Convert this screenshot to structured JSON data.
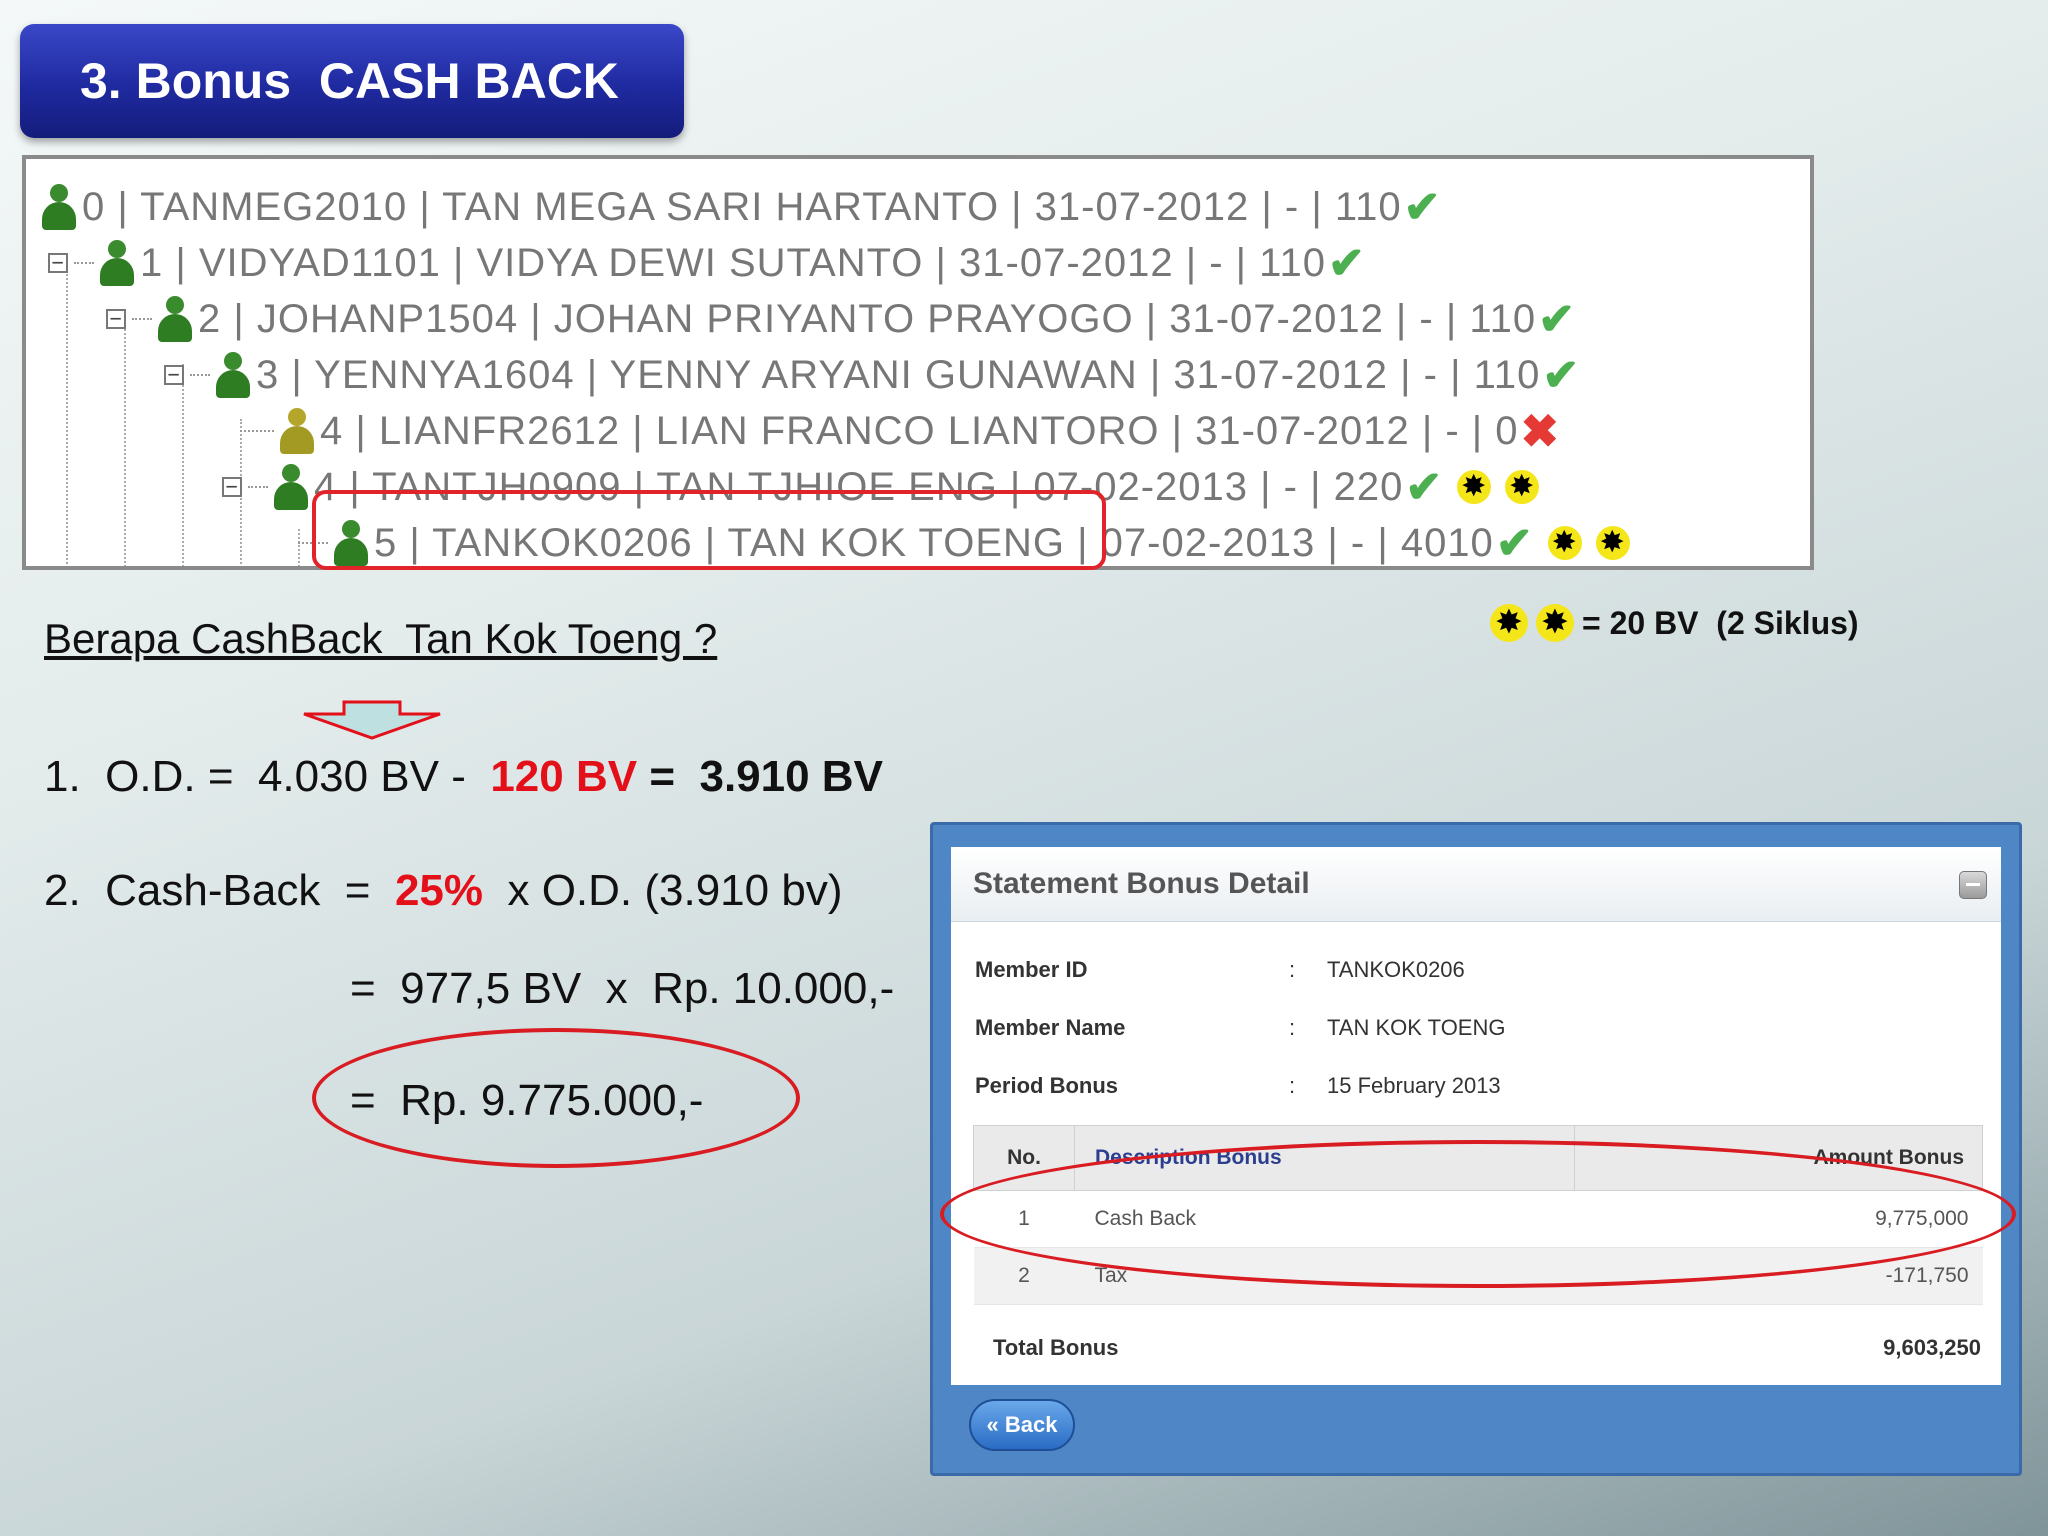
{
  "title": "3. Bonus  CASH BACK",
  "tree": [
    {
      "text": "0 | TANMEG2010 | TAN MEGA SARI HARTANTO | 31-07-2012 | - | 110",
      "status": "check",
      "stars": 0
    },
    {
      "text": "1 | VIDYAD1101 | VIDYA DEWI SUTANTO | 31-07-2012 | - | 110",
      "status": "check",
      "stars": 0
    },
    {
      "text": "2 | JOHANP1504 | JOHAN PRIYANTO PRAYOGO | 31-07-2012 | - | 110",
      "status": "check",
      "stars": 0
    },
    {
      "text": "3 | YENNYA1604 | YENNY ARYANI GUNAWAN | 31-07-2012 | - | 110",
      "status": "check",
      "stars": 0
    },
    {
      "text": "4 | LIANFR2612 | LIAN FRANCO LIANTORO | 31-07-2012 | - | 0",
      "status": "cross",
      "stars": 0
    },
    {
      "text": "4 | TANTJH0909 | TAN TJHIOE ENG | 07-02-2013 | - | 220",
      "status": "check",
      "stars": 2
    },
    {
      "text": "5 | TANKOK0206 | TAN KOK TOENG | 07-02-2013 | - | 4010",
      "status": "check",
      "stars": 2
    }
  ],
  "question": "Berapa CashBack  Tan Kok Toeng ?",
  "legend_text": "= 20 BV  (2 Siklus)",
  "line1": {
    "a": "1.  O.D. =  4.030 BV -  ",
    "b": "120 BV",
    "c": " =  ",
    "d": "3.910 BV"
  },
  "line2": {
    "a": "2.  Cash-Back  =  ",
    "b": "25%",
    "c": "  x O.D. (3.910 bv)"
  },
  "line3": "=  977,5 BV  x  Rp. 10.000,-",
  "line4": "=  Rp. 9.775.000,-",
  "statement": {
    "title": "Statement Bonus Detail",
    "fields": [
      {
        "label": "Member ID",
        "sep": ":",
        "value": "TANKOK0206"
      },
      {
        "label": "Member Name",
        "sep": ":",
        "value": "TAN KOK TOENG"
      },
      {
        "label": "Period Bonus",
        "sep": ":",
        "value": "15 February 2013"
      }
    ],
    "columns": {
      "no": "No.",
      "desc": "Description Bonus",
      "amount": "Amount Bonus"
    },
    "rows": [
      {
        "no": "1",
        "desc": "Cash Back",
        "amount": "9,775,000"
      },
      {
        "no": "2",
        "desc": "Tax",
        "amount": "-171,750"
      }
    ],
    "total_label": "Total Bonus",
    "total_value": "9,603,250",
    "back_label": "« Back"
  }
}
